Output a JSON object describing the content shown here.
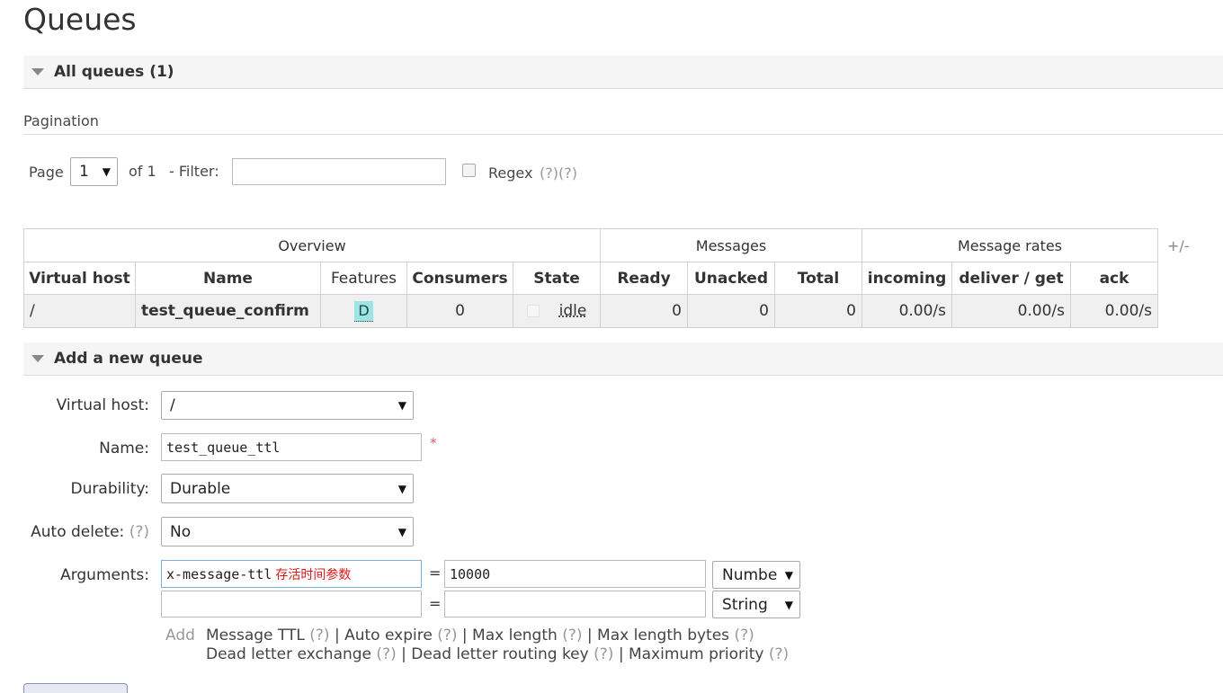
{
  "page": {
    "title": "Queues"
  },
  "all_queues": {
    "header": "All queues (1)"
  },
  "pagination": {
    "label": "Pagination",
    "page_label": "Page",
    "page_value": "1",
    "of_label": "of 1",
    "filter_label": "- Filter:",
    "filter_value": "",
    "regex_label": "Regex",
    "regex_help": "(?)(?)"
  },
  "table": {
    "groups": [
      "Overview",
      "Messages",
      "Message rates"
    ],
    "columns": [
      "Virtual host",
      "Name",
      "Features",
      "Consumers",
      "State",
      "Ready",
      "Unacked",
      "Total",
      "incoming",
      "deliver / get",
      "ack"
    ],
    "plus_minus": "+/-",
    "rows": [
      {
        "vhost": "/",
        "name": "test_queue_confirm",
        "feature": "D",
        "consumers": "0",
        "state": "idle",
        "ready": "0",
        "unacked": "0",
        "total": "0",
        "incoming": "0.00/s",
        "deliver_get": "0.00/s",
        "ack": "0.00/s"
      }
    ]
  },
  "add_queue": {
    "header": "Add a new queue",
    "vhost_label": "Virtual host:",
    "vhost_value": "/",
    "name_label": "Name:",
    "name_value": "test_queue_ttl",
    "required_mark": "*",
    "durability_label": "Durability:",
    "durability_value": "Durable",
    "autodelete_label": "Auto delete:",
    "autodelete_help": "(?)",
    "autodelete_value": "No",
    "arguments_label": "Arguments:",
    "arguments": [
      {
        "key": "x-message-ttl",
        "annotation": "存活时间参数",
        "value": "10000",
        "type": "Numbe"
      },
      {
        "key": "",
        "annotation": "",
        "value": "",
        "type": "String"
      }
    ],
    "equals": "=",
    "add_label": "Add",
    "help": "(?)",
    "separator": "|",
    "arg_links": {
      "message_ttl": "Message TTL",
      "auto_expire": "Auto expire",
      "max_length": "Max length",
      "max_length_bytes": "Max length bytes",
      "dead_letter_exchange": "Dead letter exchange",
      "dead_letter_routing_key": "Dead letter routing key",
      "maximum_priority": "Maximum priority"
    }
  },
  "icons": {
    "collapse": "triangle-down-icon",
    "dropdown": "dropdown-arrow-icon",
    "checkbox": "checkbox-icon"
  },
  "colors": {
    "feature_badge": "#9ee4e4",
    "required": "#e06060",
    "annotation": "#e01818",
    "row_bg": "#f0f0f0"
  }
}
